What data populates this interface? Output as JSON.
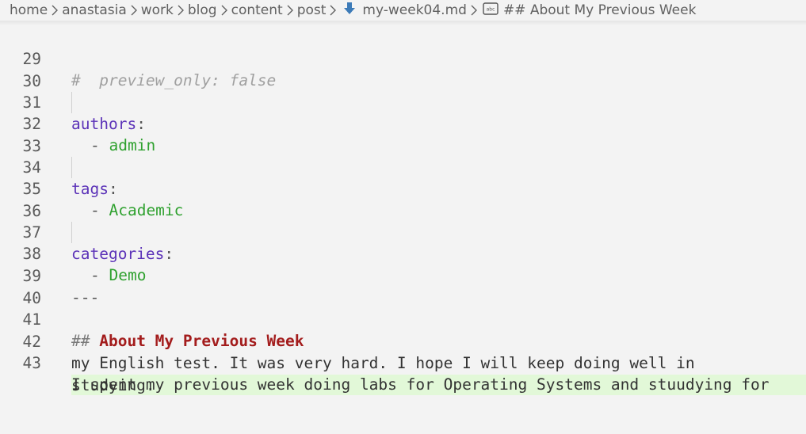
{
  "breadcrumb": {
    "items": [
      "home",
      "anastasia",
      "work",
      "blog",
      "content",
      "post",
      "my-week04.md",
      "## About My Previous Week"
    ],
    "file_icon": "markdown-down-arrow-icon",
    "symbol_icon": "string-symbol-icon"
  },
  "editor": {
    "lines": [
      {
        "num": "29",
        "comment": "#  preview_only: false"
      },
      {
        "num": "30"
      },
      {
        "num": "31",
        "key": "authors",
        "colon": ":"
      },
      {
        "num": "32",
        "dash": "- ",
        "value": "admin"
      },
      {
        "num": "33"
      },
      {
        "num": "34",
        "key": "tags",
        "colon": ":"
      },
      {
        "num": "35",
        "dash": "- ",
        "value": "Academic"
      },
      {
        "num": "36"
      },
      {
        "num": "37",
        "key": "categories",
        "colon": ":"
      },
      {
        "num": "38",
        "dash": "- ",
        "value": "Demo"
      },
      {
        "num": "39",
        "text": "---"
      },
      {
        "num": "40"
      },
      {
        "num": "41",
        "hash": "## ",
        "heading": "About My Previous Week"
      },
      {
        "num": "42"
      },
      {
        "num": "43",
        "text": "I spent my previous week doing labs for Operating Systems and stuudying for"
      }
    ],
    "wrapped": [
      "my English test. It was very hard. I hope I will keep doing well in",
      "studying."
    ]
  },
  "colors": {
    "key": "#5c33b8",
    "value": "#2fa12f",
    "heading": "#a31c1c",
    "comment": "#a0a0a0",
    "highlight": "#e2f8d8"
  }
}
